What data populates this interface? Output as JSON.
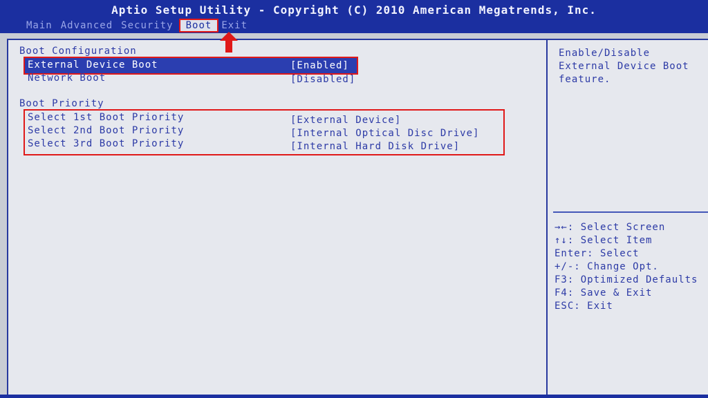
{
  "header": {
    "title": "Aptio Setup Utility - Copyright (C) 2010 American Megatrends, Inc."
  },
  "tabs": [
    {
      "label": "Main"
    },
    {
      "label": "Advanced"
    },
    {
      "label": "Security"
    },
    {
      "label": "Boot"
    },
    {
      "label": "Exit"
    }
  ],
  "main": {
    "boot_config_heading": "Boot Configuration",
    "external_device_boot": {
      "label": "External Device Boot",
      "value": "[Enabled]"
    },
    "network_boot": {
      "label": "Network Boot",
      "value": "[Disabled]"
    },
    "boot_priority_heading": "Boot Priority",
    "priorities": [
      {
        "label": "Select 1st Boot Priority",
        "value": "[External Device]"
      },
      {
        "label": "Select 2nd Boot Priority",
        "value": "[Internal Optical Disc Drive]"
      },
      {
        "label": "Select 3rd Boot Priority",
        "value": "[Internal Hard Disk Drive]"
      }
    ]
  },
  "help": {
    "description": [
      "Enable/Disable",
      "External Device Boot",
      "feature."
    ],
    "keys": [
      "→←: Select Screen",
      "↑↓: Select Item",
      "Enter: Select",
      "+/-: Change Opt.",
      "F3: Optimized Defaults",
      "F4: Save & Exit",
      "ESC: Exit"
    ]
  },
  "colors": {
    "bar": "#1b2fa0",
    "panel": "#e6e8ee",
    "text": "#2c3aa6",
    "highlight_box": "#e01818"
  }
}
